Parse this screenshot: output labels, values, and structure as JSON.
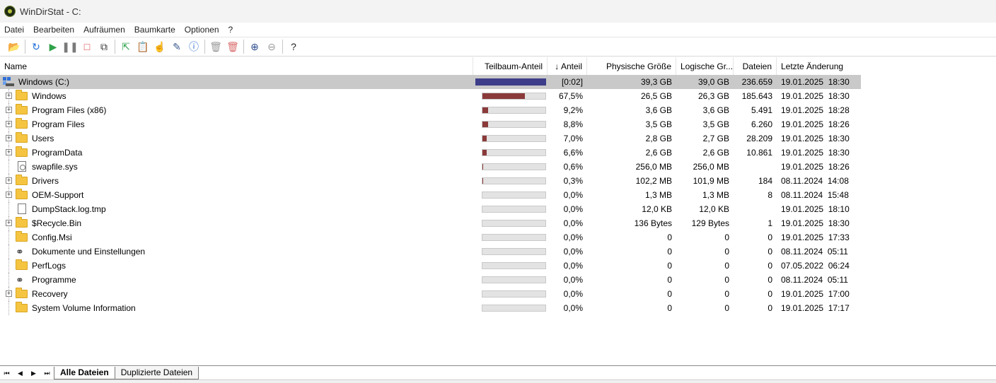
{
  "window": {
    "title": "WinDirStat - C:"
  },
  "menu": [
    "Datei",
    "Bearbeiten",
    "Aufräumen",
    "Baumkarte",
    "Optionen",
    "?"
  ],
  "toolbar": [
    {
      "icon": "open-folder-icon",
      "glyph": "📂"
    },
    {
      "sep": true
    },
    {
      "icon": "refresh-icon",
      "glyph": "↻",
      "color": "#1e6fd9"
    },
    {
      "icon": "play-icon",
      "glyph": "▶",
      "color": "#2fa24a"
    },
    {
      "icon": "pause-icon",
      "glyph": "❚❚",
      "color": "#7a7a7a"
    },
    {
      "icon": "stop-icon",
      "glyph": "□",
      "color": "#d93a3a"
    },
    {
      "icon": "copy-path-icon",
      "glyph": "⧉",
      "color": "#333333"
    },
    {
      "sep": true
    },
    {
      "icon": "open-item-icon",
      "glyph": "⇱",
      "color": "#2fa24a"
    },
    {
      "icon": "paste-icon",
      "glyph": "📋"
    },
    {
      "icon": "select-icon",
      "glyph": "☝",
      "color": "#4a7bd0"
    },
    {
      "icon": "edit-icon",
      "glyph": "✎",
      "color": "#3a5a8c"
    },
    {
      "icon": "properties-icon",
      "glyph": "ⓘ",
      "color": "#2a6fd0"
    },
    {
      "sep": true
    },
    {
      "icon": "recycle-icon",
      "glyph": "🗑",
      "color": "#9a9a9a"
    },
    {
      "icon": "delete-icon",
      "glyph": "🗑",
      "color": "#d96b6b"
    },
    {
      "sep": true
    },
    {
      "icon": "zoom-in-icon",
      "glyph": "⊕",
      "color": "#2a4a8c"
    },
    {
      "icon": "zoom-out-icon",
      "glyph": "⊖",
      "color": "#9a9a9a"
    },
    {
      "sep": true
    },
    {
      "icon": "help-icon",
      "glyph": "?",
      "color": "#222222"
    }
  ],
  "columns": {
    "name": "Name",
    "subtree": "Teilbaum-Anteil",
    "percent": "↓ Anteil",
    "physical": "Physische Größe",
    "logical": "Logische Gr...",
    "files": "Dateien",
    "modified": "Letzte Änderung"
  },
  "rows": [
    {
      "kind": "root",
      "name": "Windows (C:)",
      "fill": 1.0,
      "percent": "[0:02]",
      "physical": "39,3 GB",
      "logical": "39,0 GB",
      "files": "236.659",
      "modified": "19.01.2025  18:30"
    },
    {
      "kind": "folder",
      "expandable": true,
      "name": "Windows",
      "fill": 0.675,
      "percent": "67,5%",
      "physical": "26,5 GB",
      "logical": "26,3 GB",
      "files": "185.643",
      "modified": "19.01.2025  18:30"
    },
    {
      "kind": "folder",
      "expandable": true,
      "name": "Program Files (x86)",
      "fill": 0.092,
      "percent": "9,2%",
      "physical": "3,6 GB",
      "logical": "3,6 GB",
      "files": "5.491",
      "modified": "19.01.2025  18:28"
    },
    {
      "kind": "folder",
      "expandable": true,
      "name": "Program Files",
      "fill": 0.088,
      "percent": "8,8%",
      "physical": "3,5 GB",
      "logical": "3,5 GB",
      "files": "6.260",
      "modified": "19.01.2025  18:26"
    },
    {
      "kind": "folder",
      "expandable": true,
      "name": "Users",
      "fill": 0.07,
      "percent": "7,0%",
      "physical": "2,8 GB",
      "logical": "2,7 GB",
      "files": "28.209",
      "modified": "19.01.2025  18:30"
    },
    {
      "kind": "folder",
      "expandable": true,
      "name": "ProgramData",
      "fill": 0.066,
      "percent": "6,6%",
      "physical": "2,6 GB",
      "logical": "2,6 GB",
      "files": "10.861",
      "modified": "19.01.2025  18:30"
    },
    {
      "kind": "sysfile",
      "expandable": false,
      "name": "swapfile.sys",
      "fill": 0.006,
      "percent": "0,6%",
      "physical": "256,0 MB",
      "logical": "256,0 MB",
      "files": "",
      "modified": "19.01.2025  18:26"
    },
    {
      "kind": "folder",
      "expandable": true,
      "name": "Drivers",
      "fill": 0.003,
      "percent": "0,3%",
      "physical": "102,2 MB",
      "logical": "101,9 MB",
      "files": "184",
      "modified": "08.11.2024  14:08"
    },
    {
      "kind": "folder",
      "expandable": true,
      "name": "OEM-Support",
      "fill": 0.0,
      "percent": "0,0%",
      "physical": "1,3 MB",
      "logical": "1,3 MB",
      "files": "8",
      "modified": "08.11.2024  15:48"
    },
    {
      "kind": "file",
      "expandable": false,
      "name": "DumpStack.log.tmp",
      "fill": 0.0,
      "percent": "0,0%",
      "physical": "12,0 KB",
      "logical": "12,0 KB",
      "files": "",
      "modified": "19.01.2025  18:10"
    },
    {
      "kind": "folder",
      "expandable": true,
      "name": "$Recycle.Bin",
      "fill": 0.0,
      "percent": "0,0%",
      "physical": "136 Bytes",
      "logical": "129 Bytes",
      "files": "1",
      "modified": "19.01.2025  18:30"
    },
    {
      "kind": "folder",
      "expandable": false,
      "name": "Config.Msi",
      "fill": 0.0,
      "percent": "0,0%",
      "physical": "0",
      "logical": "0",
      "files": "0",
      "modified": "19.01.2025  17:33"
    },
    {
      "kind": "link",
      "expandable": false,
      "name": "Dokumente und Einstellungen",
      "fill": 0.0,
      "percent": "0,0%",
      "physical": "0",
      "logical": "0",
      "files": "0",
      "modified": "08.11.2024  05:11"
    },
    {
      "kind": "folder",
      "expandable": false,
      "name": "PerfLogs",
      "fill": 0.0,
      "percent": "0,0%",
      "physical": "0",
      "logical": "0",
      "files": "0",
      "modified": "07.05.2022  06:24"
    },
    {
      "kind": "link",
      "expandable": false,
      "name": "Programme",
      "fill": 0.0,
      "percent": "0,0%",
      "physical": "0",
      "logical": "0",
      "files": "0",
      "modified": "08.11.2024  05:11"
    },
    {
      "kind": "folder",
      "expandable": true,
      "name": "Recovery",
      "fill": 0.0,
      "percent": "0,0%",
      "physical": "0",
      "logical": "0",
      "files": "0",
      "modified": "19.01.2025  17:00"
    },
    {
      "kind": "folder",
      "expandable": false,
      "name": "System Volume Information",
      "fill": 0.0,
      "percent": "0,0%",
      "physical": "0",
      "logical": "0",
      "files": "0",
      "modified": "19.01.2025  17:17"
    }
  ],
  "footer": {
    "nav": [
      "⏮",
      "◀",
      "▶",
      "⏭"
    ],
    "tabs": [
      "Alle Dateien",
      "Duplizierte Dateien"
    ]
  }
}
